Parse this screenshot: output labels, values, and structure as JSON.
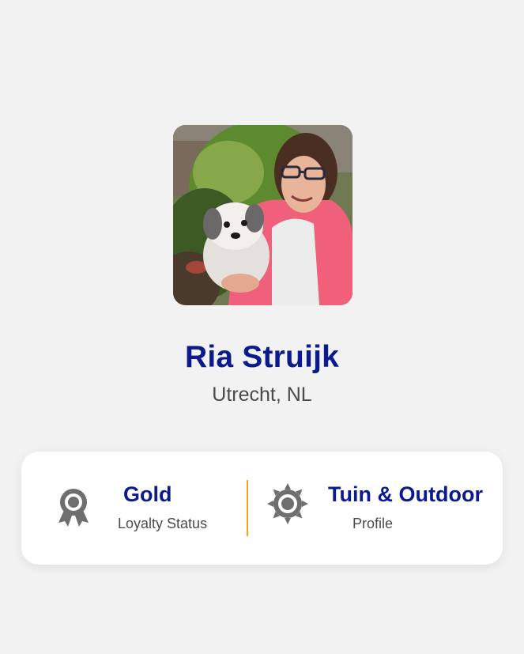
{
  "profile": {
    "name": "Ria Struijk",
    "location": "Utrecht, NL",
    "photo_icon": "profile-photo"
  },
  "stats": [
    {
      "value": "Gold",
      "label": "Loyalty Status",
      "icon": "award-ribbon-icon"
    },
    {
      "value": "Tuin & Outdoor",
      "label": "Profile",
      "icon": "sun-icon"
    }
  ],
  "colors": {
    "primary": "#0b1a8c",
    "divider": "#f0a02e",
    "icon": "#6e6e6e",
    "background": "#f2f2f2",
    "card": "#ffffff"
  }
}
